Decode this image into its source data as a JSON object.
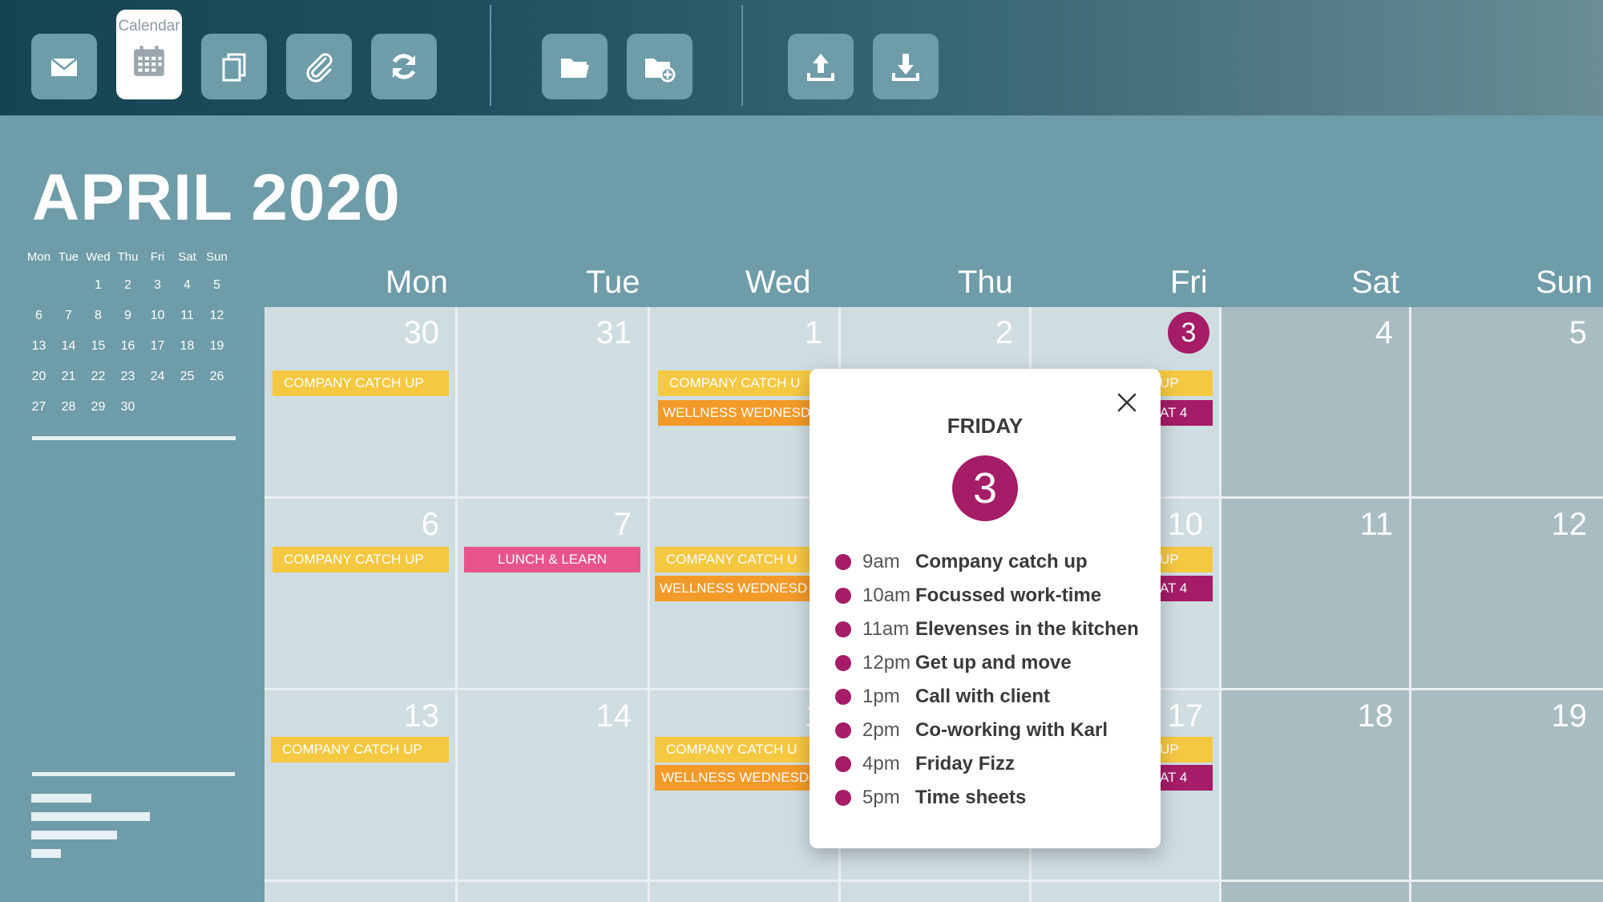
{
  "toolbar": {
    "buttons": [
      {
        "name": "mail-icon"
      },
      {
        "name": "calendar-icon",
        "label": "Calendar"
      },
      {
        "name": "copy-icon"
      },
      {
        "name": "paperclip-icon"
      },
      {
        "name": "sync-icon"
      },
      {
        "name": "folder-icon"
      },
      {
        "name": "folder-add-icon"
      },
      {
        "name": "upload-icon"
      },
      {
        "name": "download-icon"
      }
    ]
  },
  "calendar": {
    "month_title": "APRIL 2020"
  },
  "mini_calendar": {
    "weekdays": [
      "Mon",
      "Tue",
      "Wed",
      "Thu",
      "Fri",
      "Sat",
      "Sun"
    ],
    "rows": [
      [
        "",
        "",
        "1",
        "2",
        "3",
        "4",
        "5"
      ],
      [
        "6",
        "7",
        "8",
        "9",
        "10",
        "11",
        "12"
      ],
      [
        "13",
        "14",
        "15",
        "16",
        "17",
        "18",
        "19"
      ],
      [
        "20",
        "21",
        "22",
        "23",
        "24",
        "25",
        "26"
      ],
      [
        "27",
        "28",
        "29",
        "30",
        "",
        "",
        ""
      ]
    ]
  },
  "week_header": [
    "Mon",
    "Tue",
    "Wed",
    "Thu",
    "Fri",
    "Sat",
    "Sun"
  ],
  "grid": {
    "row1": [
      "30",
      "31",
      "1",
      "2",
      "3",
      "4",
      "5"
    ],
    "row2": [
      "6",
      "7",
      "",
      "",
      "10",
      "11",
      "12"
    ],
    "row3": [
      "13",
      "14",
      "1",
      "",
      "17",
      "18",
      "19"
    ]
  },
  "events": {
    "company_catch_up": "COMPANY CATCH UP",
    "company_catch_up_cut": "COMPANY CATCH U",
    "wellness": "WELLNESS WEDNESD",
    "lunch_learn": "LUNCH & LEARN",
    "fri_top": "UP",
    "fri_bottom": "AT 4"
  },
  "popup": {
    "day_label": "FRIDAY",
    "day_number": "3",
    "events": [
      {
        "time": "9am",
        "title": "Company catch up"
      },
      {
        "time": "10am",
        "title": "Focussed work-time"
      },
      {
        "time": "11am",
        "title": "Elevenses in the kitchen"
      },
      {
        "time": "12pm",
        "title": "Get up and move"
      },
      {
        "time": "1pm",
        "title": "Call with client"
      },
      {
        "time": "2pm",
        "title": "Co-working with Karl"
      },
      {
        "time": "4pm",
        "title": "Friday Fizz"
      },
      {
        "time": "5pm",
        "title": "Time sheets"
      }
    ]
  },
  "colors": {
    "accent": "#a51c67",
    "yellow": "#f5c842",
    "orange": "#f39a28",
    "pink": "#e8548a",
    "background": "#6e9ca8"
  }
}
